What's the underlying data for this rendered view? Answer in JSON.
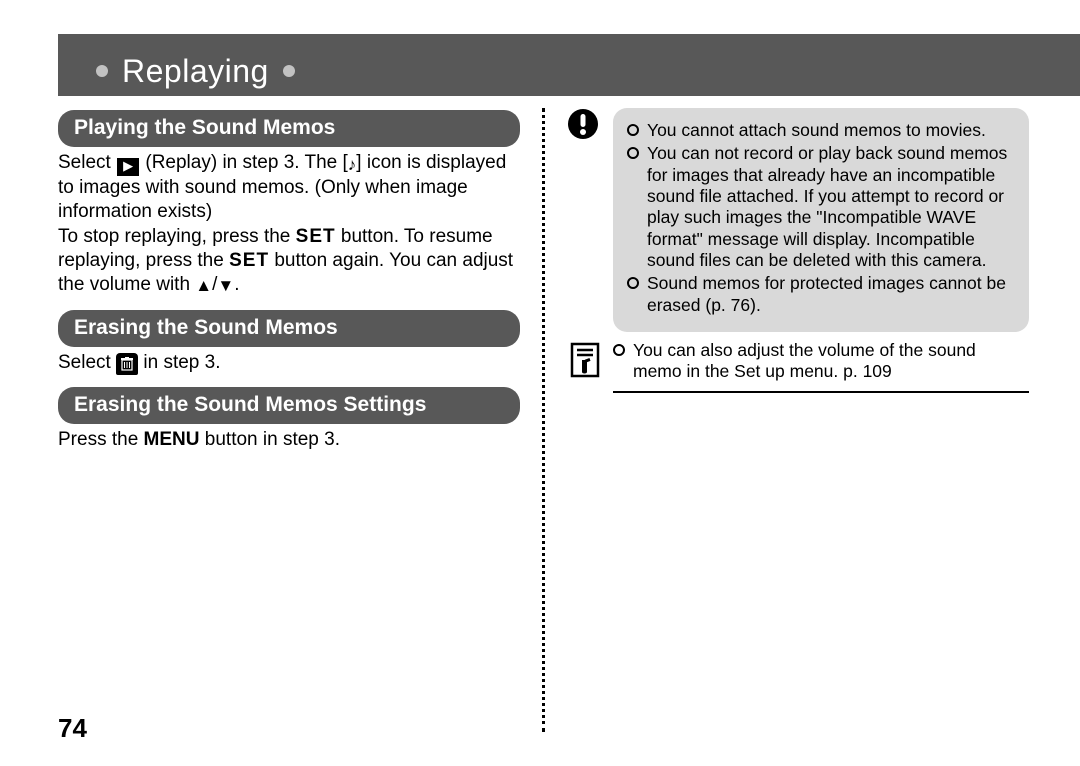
{
  "page_number": "74",
  "title": "Replaying",
  "sections": {
    "play": {
      "heading": "Playing the Sound Memos",
      "p1a": "Select ",
      "p1b": " (Replay) in step 3. The [",
      "p1c": "] icon is displayed to images with sound memos. (Only when image information exists)",
      "p2a": "To stop replaying, press the ",
      "p2b": " button. To resume replaying, press the ",
      "p2c": " button again. You can adjust the volume with ",
      "set_label": "SET"
    },
    "erase": {
      "heading": "Erasing the Sound Memos",
      "p1a": "Select ",
      "p1b": " in step 3."
    },
    "erase_settings": {
      "heading": "Erasing the Sound Memos Settings",
      "p1a": "Press the ",
      "menu_label": "MENU",
      "p1b": " button in step 3."
    }
  },
  "warnings": [
    "You cannot attach sound memos to movies.",
    "You can not record or play back sound memos for images that already have an incompatible sound file attached. If you attempt to record or play such images the \"Incompatible WAVE format\" message will display. Incompatible sound files can be deleted with this camera.",
    "Sound memos for protected images cannot be erased (p. 76)."
  ],
  "tip": "You can also adjust the volume of the sound memo in the Set up menu. p. 109",
  "icons": {
    "replay": "▶",
    "music": "♪",
    "trash": "🗑",
    "up": "▲",
    "down": "▼"
  }
}
